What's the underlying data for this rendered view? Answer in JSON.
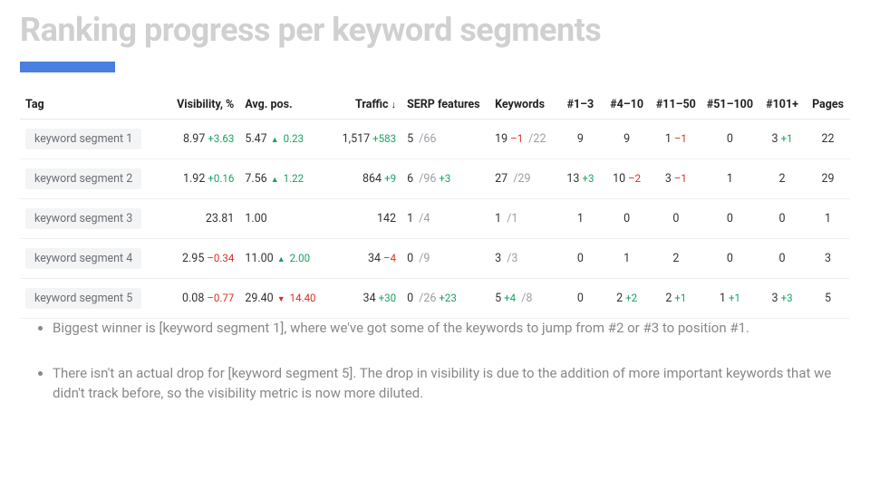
{
  "title": "Ranking progress per keyword segments",
  "columns": {
    "tag": "Tag",
    "visibility": "Visibility, %",
    "avg_pos": "Avg. pos.",
    "traffic": "Traffic",
    "serp": "SERP features",
    "keywords": "Keywords",
    "b1": "#1–3",
    "b2": "#4–10",
    "b3": "#11–50",
    "b4": "#51–100",
    "b5": "#101+",
    "pages": "Pages"
  },
  "sort_indicator": "↓",
  "rows": [
    {
      "tag": "keyword segment 1",
      "visibility": "8.97",
      "visibility_delta": "+3.63",
      "visibility_delta_sign": "pos",
      "avg_pos": "5.47",
      "avg_pos_dir": "up",
      "avg_pos_delta": "0.23",
      "traffic": "1,517",
      "traffic_delta": "+583",
      "traffic_delta_sign": "pos",
      "serp_val": "5",
      "serp_total": "/66",
      "serp_delta": "",
      "serp_delta_sign": "",
      "kw_val": "19",
      "kw_delta": "–1",
      "kw_delta_sign": "neg",
      "kw_total": "/22",
      "b1": "9",
      "b1_delta": "",
      "b1_sign": "",
      "b2": "9",
      "b2_delta": "",
      "b2_sign": "",
      "b3": "1",
      "b3_delta": "–1",
      "b3_sign": "neg",
      "b4": "0",
      "b4_delta": "",
      "b4_sign": "",
      "b5": "3",
      "b5_delta": "+1",
      "b5_sign": "pos",
      "pages": "22"
    },
    {
      "tag": "keyword segment 2",
      "visibility": "1.92",
      "visibility_delta": "+0.16",
      "visibility_delta_sign": "pos",
      "avg_pos": "7.56",
      "avg_pos_dir": "up",
      "avg_pos_delta": "1.22",
      "traffic": "864",
      "traffic_delta": "+9",
      "traffic_delta_sign": "pos",
      "serp_val": "6",
      "serp_total": "/96",
      "serp_delta": "+3",
      "serp_delta_sign": "pos",
      "kw_val": "27",
      "kw_delta": "",
      "kw_delta_sign": "",
      "kw_total": "/29",
      "b1": "13",
      "b1_delta": "+3",
      "b1_sign": "pos",
      "b2": "10",
      "b2_delta": "–2",
      "b2_sign": "neg",
      "b3": "3",
      "b3_delta": "–1",
      "b3_sign": "neg",
      "b4": "1",
      "b4_delta": "",
      "b4_sign": "",
      "b5": "2",
      "b5_delta": "",
      "b5_sign": "",
      "pages": "29"
    },
    {
      "tag": "keyword segment 3",
      "visibility": "23.81",
      "visibility_delta": "",
      "visibility_delta_sign": "",
      "avg_pos": "1.00",
      "avg_pos_dir": "",
      "avg_pos_delta": "",
      "traffic": "142",
      "traffic_delta": "",
      "traffic_delta_sign": "",
      "serp_val": "1",
      "serp_total": "/4",
      "serp_delta": "",
      "serp_delta_sign": "",
      "kw_val": "1",
      "kw_delta": "",
      "kw_delta_sign": "",
      "kw_total": "/1",
      "b1": "1",
      "b1_delta": "",
      "b1_sign": "",
      "b2": "0",
      "b2_delta": "",
      "b2_sign": "",
      "b3": "0",
      "b3_delta": "",
      "b3_sign": "",
      "b4": "0",
      "b4_delta": "",
      "b4_sign": "",
      "b5": "0",
      "b5_delta": "",
      "b5_sign": "",
      "pages": "1"
    },
    {
      "tag": "keyword segment 4",
      "visibility": "2.95",
      "visibility_delta": "–0.34",
      "visibility_delta_sign": "neg",
      "avg_pos": "11.00",
      "avg_pos_dir": "up",
      "avg_pos_delta": "2.00",
      "traffic": "34",
      "traffic_delta": "–4",
      "traffic_delta_sign": "neg",
      "serp_val": "0",
      "serp_total": "/9",
      "serp_delta": "",
      "serp_delta_sign": "",
      "kw_val": "3",
      "kw_delta": "",
      "kw_delta_sign": "",
      "kw_total": "/3",
      "b1": "0",
      "b1_delta": "",
      "b1_sign": "",
      "b2": "1",
      "b2_delta": "",
      "b2_sign": "",
      "b3": "2",
      "b3_delta": "",
      "b3_sign": "",
      "b4": "0",
      "b4_delta": "",
      "b4_sign": "",
      "b5": "0",
      "b5_delta": "",
      "b5_sign": "",
      "pages": "3"
    },
    {
      "tag": "keyword segment 5",
      "visibility": "0.08",
      "visibility_delta": "–0.77",
      "visibility_delta_sign": "neg",
      "avg_pos": "29.40",
      "avg_pos_dir": "down",
      "avg_pos_delta": "14.40",
      "traffic": "34",
      "traffic_delta": "+30",
      "traffic_delta_sign": "pos",
      "serp_val": "0",
      "serp_total": "/26",
      "serp_delta": "+23",
      "serp_delta_sign": "pos",
      "kw_val": "5",
      "kw_delta": "+4",
      "kw_delta_sign": "pos",
      "kw_total": "/8",
      "b1": "0",
      "b1_delta": "",
      "b1_sign": "",
      "b2": "2",
      "b2_delta": "+2",
      "b2_sign": "pos",
      "b3": "2",
      "b3_delta": "+1",
      "b3_sign": "pos",
      "b4": "1",
      "b4_delta": "+1",
      "b4_sign": "pos",
      "b5": "3",
      "b5_delta": "+3",
      "b5_sign": "pos",
      "pages": "5"
    }
  ],
  "bullets": [
    "Biggest winner is [keyword segment 1], where we've got some of the keywords to jump from #2 or #3 to position #1.",
    "There isn't an actual drop for [keyword segment 5]. The drop in visibility is due to the addition of more important keywords that we didn't track before, so the visibility metric is now more diluted."
  ]
}
